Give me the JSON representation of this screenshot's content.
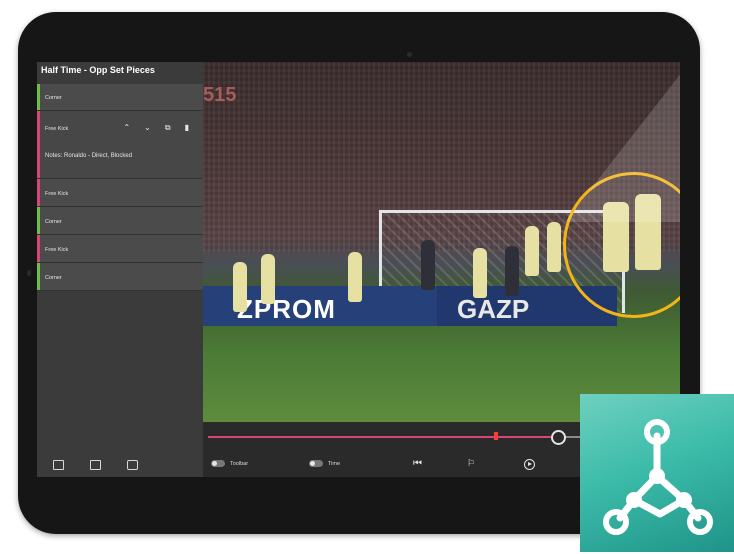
{
  "sidebar": {
    "title": "Half Time - Opp Set Pieces",
    "items": [
      {
        "label": "Corner",
        "color": "#6fbf45"
      },
      {
        "label": "Free Kick",
        "color": "#d8457a",
        "detail": "Notes: Ronaldo - Direct, Blocked",
        "expanded": true
      },
      {
        "label": "Free Kick",
        "color": "#d8457a"
      },
      {
        "label": "Corner",
        "color": "#6fbf45"
      },
      {
        "label": "Free Kick",
        "color": "#d8457a"
      },
      {
        "label": "Corner",
        "color": "#6fbf45"
      }
    ],
    "action_icons": [
      "chevron-up-icon",
      "chevron-down-icon",
      "copy-icon",
      "trash-icon"
    ],
    "bottom_icons": [
      "add-clip-icon",
      "export-icon",
      "camera-icon"
    ]
  },
  "video": {
    "scoreboard_text": "515",
    "board_text": "ZPROM",
    "board_text_2": "GAZP"
  },
  "timeline": {
    "progress": 0.73,
    "marker_position": 0.61,
    "controls": [
      {
        "label": "Toolbar"
      },
      {
        "label": "Time"
      }
    ]
  },
  "colors": {
    "accent_pink": "#d8457a",
    "accent_green": "#6fbf45",
    "highlight_yellow": "#f2b516",
    "logo_teal": "#3dbcaa"
  }
}
